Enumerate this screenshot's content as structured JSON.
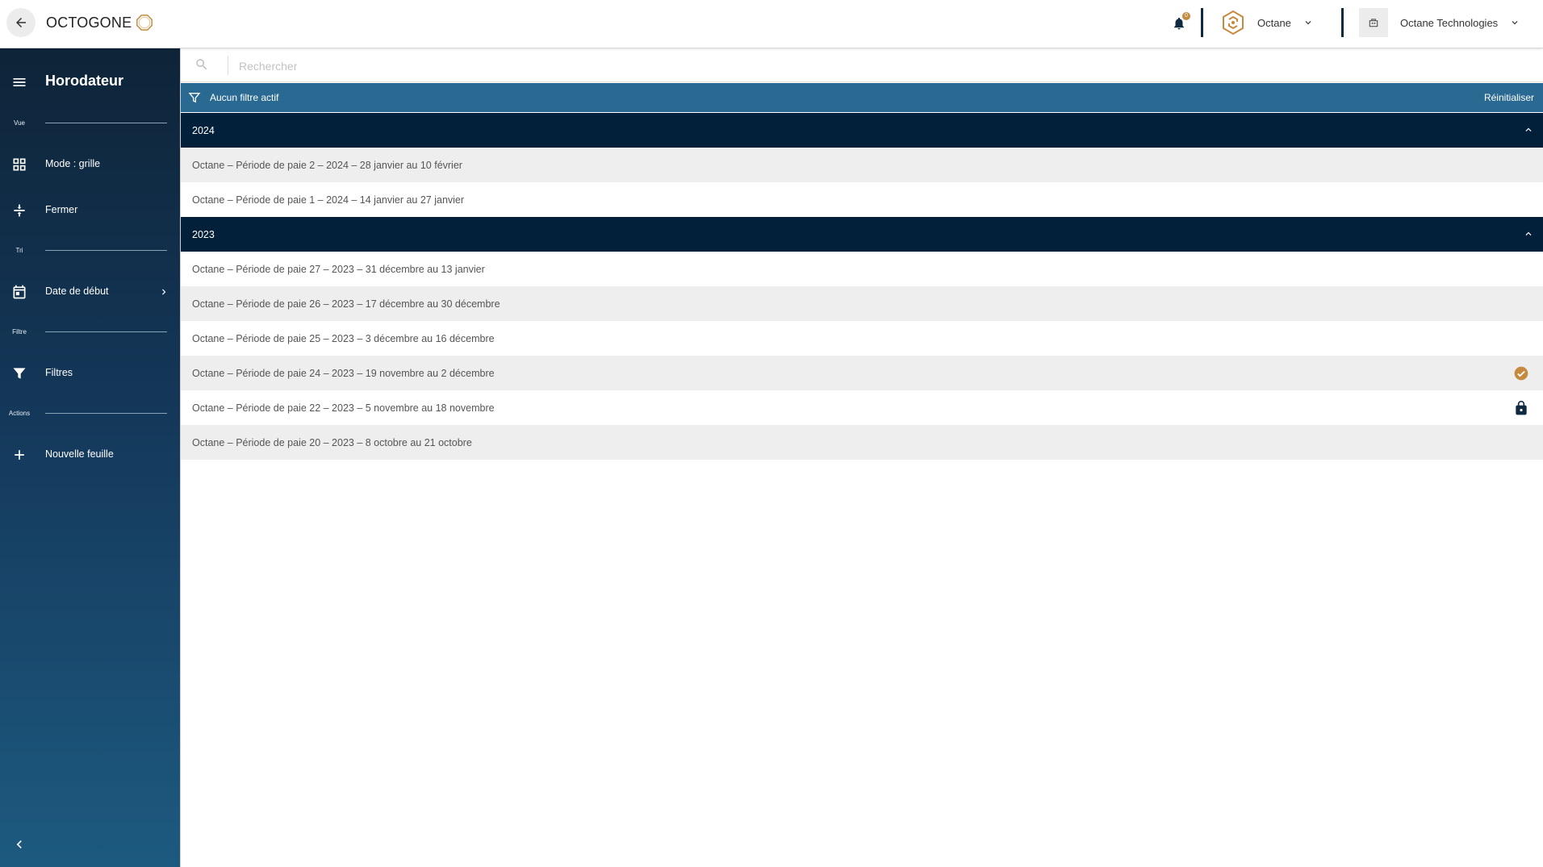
{
  "header": {
    "logo_text": "OCTOGONE",
    "notification_count": "0",
    "company_label": "Octane",
    "organization_label": "Octane Technologies"
  },
  "sidebar": {
    "title": "Horodateur",
    "sections": {
      "view": "Vue",
      "sort": "Tri",
      "filter": "Filtre",
      "actions": "Actions"
    },
    "items": {
      "mode": "Mode : grille",
      "close": "Fermer",
      "start_date": "Date de début",
      "filters": "Filtres",
      "new_sheet": "Nouvelle feuille"
    }
  },
  "search": {
    "placeholder": "Rechercher"
  },
  "filter_bar": {
    "label": "Aucun filtre actif",
    "reset": "Réinitialiser"
  },
  "groups": [
    {
      "year": "2024",
      "rows": [
        {
          "label": "Octane – Période de paie 2 – 2024 – 28 janvier au 10 février",
          "status": ""
        },
        {
          "label": "Octane – Période de paie 1 – 2024 – 14 janvier au 27 janvier",
          "status": ""
        }
      ]
    },
    {
      "year": "2023",
      "rows": [
        {
          "label": "Octane – Période de paie 27 – 2023 – 31 décembre au 13 janvier",
          "status": ""
        },
        {
          "label": "Octane – Période de paie 26 – 2023 – 17 décembre au 30 décembre",
          "status": ""
        },
        {
          "label": "Octane – Période de paie 25 – 2023 – 3 décembre au 16 décembre",
          "status": ""
        },
        {
          "label": "Octane – Période de paie 24 – 2023 – 19 novembre au 2 décembre",
          "status": "check-circle-icon"
        },
        {
          "label": "Octane – Période de paie 22 – 2023 – 5 novembre au 18 novembre",
          "status": "lock-icon"
        },
        {
          "label": "Octane – Période de paie 20 – 2023 – 8 octobre au 21 octobre",
          "status": ""
        }
      ]
    }
  ],
  "colors": {
    "accent": "#c58a3e",
    "navy": "#03203a",
    "filter_bar": "#2a6a92"
  }
}
